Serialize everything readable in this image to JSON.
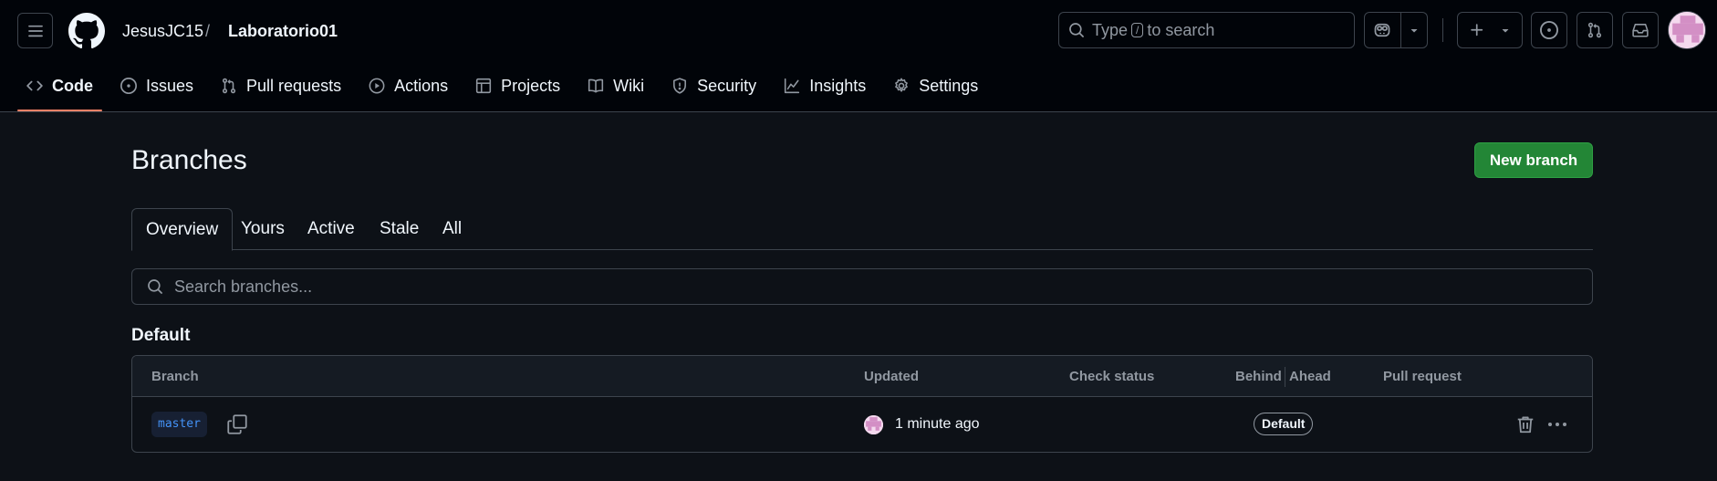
{
  "header": {
    "owner": "JesusJC15",
    "separator": "/",
    "repo": "Laboratorio01",
    "search": {
      "prefix": "Type",
      "key": "/",
      "suffix": "to search"
    }
  },
  "nav": {
    "items": [
      {
        "label": "Code",
        "icon": "code-icon",
        "active": true
      },
      {
        "label": "Issues",
        "icon": "issue-opened-icon"
      },
      {
        "label": "Pull requests",
        "icon": "git-pull-request-icon"
      },
      {
        "label": "Actions",
        "icon": "play-icon"
      },
      {
        "label": "Projects",
        "icon": "table-icon"
      },
      {
        "label": "Wiki",
        "icon": "book-icon"
      },
      {
        "label": "Security",
        "icon": "shield-icon"
      },
      {
        "label": "Insights",
        "icon": "graph-icon"
      },
      {
        "label": "Settings",
        "icon": "gear-icon"
      }
    ]
  },
  "page": {
    "title": "Branches",
    "new_branch_label": "New branch",
    "tabs": [
      "Overview",
      "Yours",
      "Active",
      "Stale",
      "All"
    ],
    "active_tab": "Overview",
    "search_placeholder": "Search branches...",
    "section_title": "Default"
  },
  "table": {
    "columns": {
      "branch": "Branch",
      "updated": "Updated",
      "check_status": "Check status",
      "behind": "Behind",
      "ahead": "Ahead",
      "pull_request": "Pull request"
    },
    "rows": [
      {
        "branch": "master",
        "updated": "1 minute ago",
        "badge": "Default"
      }
    ]
  },
  "colors": {
    "background": "#0d1117",
    "header_bg": "#010409",
    "border": "#3d444d",
    "accent_underline": "#f78166",
    "primary_button": "#238636",
    "branch_link": "#4493f8"
  }
}
